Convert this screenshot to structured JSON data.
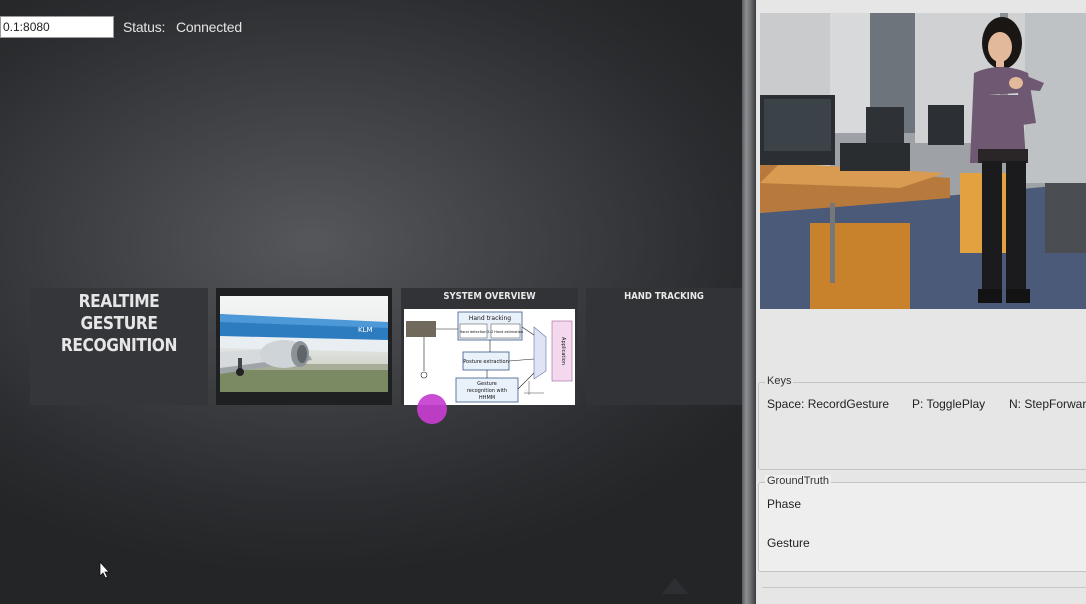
{
  "connection": {
    "address": "0.1:8080",
    "status_label": "Status:",
    "status_value": "Connected"
  },
  "slides": {
    "title_line1": "REALTIME GESTURE",
    "title_line2": "RECOGNITION",
    "system_title": "SYSTEM OVERVIEW",
    "hand_title": "HAND TRACKING",
    "diagram": {
      "box_hand_tracking": "Hand tracking",
      "box_hand_detection": "Hand detection",
      "box_3d_estimation": "3-D Hand estimation",
      "box_posture": "Posture extraction",
      "box_gesture_line1": "Gesture",
      "box_gesture_line2": "recognition with",
      "box_gesture_line3": "HHMM",
      "box_application": "Application"
    }
  },
  "panel": {
    "keys_legend": "Keys",
    "keys": [
      "Space: RecordGesture",
      "P: TogglePlay",
      "N: StepForward"
    ],
    "groundtruth_legend": "GroundTruth",
    "phase_label": "Phase",
    "gesture_label": "Gesture"
  },
  "colors": {
    "pointer_dot": "#c63ecf",
    "stage_background": "#2b2c2f",
    "panel_background": "#e6e6e6"
  },
  "icons": {
    "cursor": "mouse-pointer-icon",
    "next": "triangle-nav-icon"
  }
}
